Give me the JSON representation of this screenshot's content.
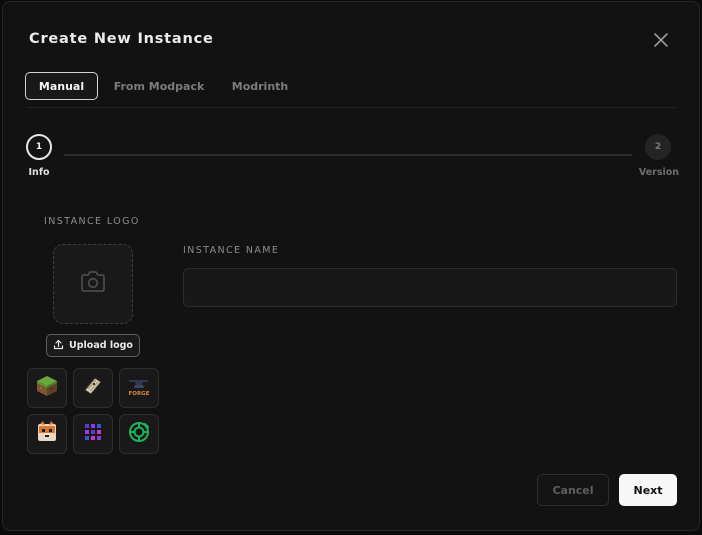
{
  "dialog": {
    "title": "Create New Instance"
  },
  "tabs": [
    {
      "label": "Manual",
      "active": true
    },
    {
      "label": "From Modpack",
      "active": false
    },
    {
      "label": "Modrinth",
      "active": false
    }
  ],
  "stepper": {
    "steps": [
      {
        "number": "1",
        "label": "Info",
        "active": true
      },
      {
        "number": "2",
        "label": "Version",
        "active": false
      }
    ]
  },
  "logo": {
    "label": "INSTANCE LOGO",
    "upload_label": "Upload logo",
    "presets": [
      {
        "name": "grass-block-icon"
      },
      {
        "name": "fabric-icon"
      },
      {
        "name": "forge-icon",
        "text": "FORGE"
      },
      {
        "name": "fox-icon"
      },
      {
        "name": "purple-grid-icon"
      },
      {
        "name": "green-gear-icon"
      }
    ]
  },
  "instance_name": {
    "label": "INSTANCE NAME",
    "value": "",
    "placeholder": ""
  },
  "footer": {
    "cancel_label": "Cancel",
    "next_label": "Next"
  },
  "colors": {
    "background": "#121212",
    "primary_button": "#f7f7f7",
    "text": "#e8e8e8",
    "muted": "#7c7c7c"
  }
}
